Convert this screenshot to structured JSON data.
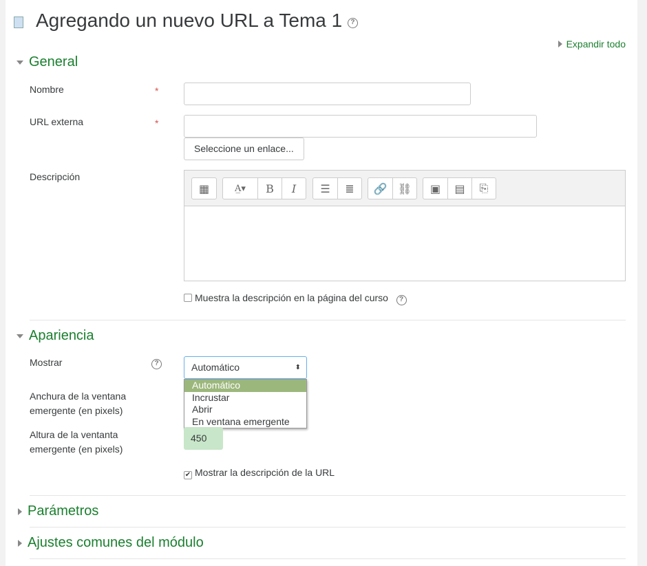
{
  "title": "Agregando un nuevo URL a Tema 1",
  "expand_all": "Expandir todo",
  "sections": {
    "general": "General",
    "appearance": "Apariencia",
    "parameters": "Parámetros",
    "common": "Ajustes comunes del módulo"
  },
  "fields": {
    "name_label": "Nombre",
    "name_value": "",
    "url_label": "URL externa",
    "url_value": "",
    "choose_link": "Seleccione un enlace...",
    "description_label": "Descripción",
    "show_desc_course": "Muestra la descripción en la página del curso",
    "display_label": "Mostrar",
    "display_value": "Automático",
    "display_options": [
      "Automático",
      "Incrustar",
      "Abrir",
      "En ventana emergente"
    ],
    "popup_width_label_1": "Anchura de la ventana",
    "popup_width_label_2": "emergente (en pixels)",
    "popup_height_label_1": "Altura de la ventanta",
    "popup_height_label_2": "emergente (en pixels)",
    "popup_height_value": "450",
    "show_url_desc": "Mostrar la descripción de la URL"
  },
  "required_mark": "*",
  "help_glyph": "?",
  "colors": {
    "accent": "#1a7f2e",
    "highlight": "#9cb77c"
  }
}
